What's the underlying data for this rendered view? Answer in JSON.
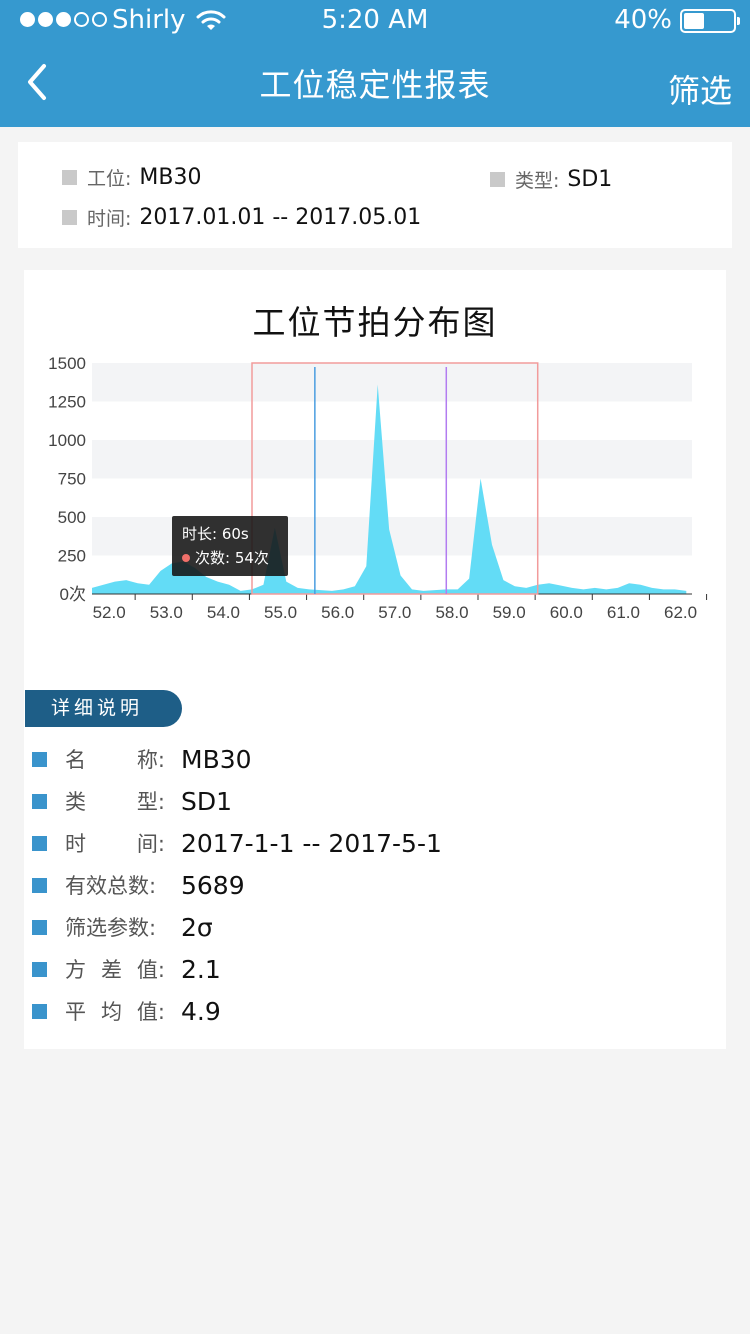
{
  "status_bar": {
    "carrier": "Shirly",
    "time": "5:20 AM",
    "battery": "40%",
    "battery_level": 0.4,
    "signal_bars": 3
  },
  "nav": {
    "title": "工位稳定性报表",
    "filter_label": "筛选",
    "back_icon": "chevron-left-icon"
  },
  "info": {
    "station_label": "工位:",
    "station_value": "MB30",
    "type_label": "类型:",
    "type_value": "SD1",
    "time_label": "时间:",
    "time_value": "2017.01.01 -- 2017.05.01"
  },
  "chart_data": {
    "type": "area",
    "title": "工位节拍分布图",
    "y_tick_labels": [
      "1500",
      "1250",
      "1000",
      "750",
      "500",
      "250",
      "0次"
    ],
    "x_tick_labels": [
      "52.0",
      "53.0",
      "54.0",
      "55.0",
      "56.0",
      "57.0",
      "58.0",
      "59.0",
      "60.0",
      "61.0",
      "62.0"
    ],
    "ylim": [
      0,
      1500
    ],
    "xlim": [
      51.7,
      62.2
    ],
    "x": [
      51.7,
      51.9,
      52.1,
      52.3,
      52.5,
      52.7,
      52.9,
      53.1,
      53.3,
      53.5,
      53.7,
      53.9,
      54.1,
      54.3,
      54.5,
      54.7,
      54.9,
      55.1,
      55.3,
      55.5,
      55.7,
      55.9,
      56.1,
      56.3,
      56.5,
      56.7,
      56.9,
      57.1,
      57.3,
      57.5,
      57.7,
      57.9,
      58.1,
      58.3,
      58.5,
      58.7,
      58.9,
      59.1,
      59.3,
      59.5,
      59.7,
      59.9,
      60.1,
      60.3,
      60.5,
      60.7,
      60.9,
      61.1,
      61.3,
      61.5,
      61.7,
      61.9,
      62.1
    ],
    "y": [
      40,
      60,
      80,
      90,
      70,
      60,
      150,
      200,
      210,
      170,
      110,
      80,
      60,
      20,
      30,
      60,
      430,
      80,
      40,
      30,
      25,
      20,
      30,
      50,
      180,
      1360,
      420,
      120,
      30,
      20,
      25,
      30,
      30,
      100,
      750,
      320,
      90,
      50,
      40,
      60,
      70,
      55,
      40,
      30,
      40,
      30,
      40,
      70,
      60,
      40,
      30,
      30,
      20
    ],
    "selection_range": [
      54.5,
      59.5
    ],
    "markers": [
      {
        "x": 55.6,
        "color": "#4a9de0"
      },
      {
        "x": 57.9,
        "color": "#b27cf0"
      }
    ],
    "grid": "horizontal bands",
    "fill_color": "#63dcf6",
    "tooltip": {
      "line1": "时长: 60s",
      "line2": "次数: 54次",
      "dot_color": "#f0706a"
    }
  },
  "detail": {
    "tab_label": "详细说明",
    "rows": [
      {
        "label_chars": [
          "名",
          "称:"
        ],
        "value": "MB30"
      },
      {
        "label_chars": [
          "类",
          "型:"
        ],
        "value": "SD1"
      },
      {
        "label_chars": [
          "时",
          "间:"
        ],
        "value": "2017-1-1 -- 2017-5-1"
      },
      {
        "label_chars": [
          "有效总数:"
        ],
        "value": "5689"
      },
      {
        "label_chars": [
          "筛选参数:"
        ],
        "value": "2σ"
      },
      {
        "label_chars": [
          "方",
          "差",
          "值:"
        ],
        "value": "2.1"
      },
      {
        "label_chars": [
          "平",
          "均",
          "值:"
        ],
        "value": "4.9"
      }
    ]
  },
  "colors": {
    "header": "#3699cf",
    "tab": "#1e5e87",
    "bullet": "#3a94cc"
  }
}
